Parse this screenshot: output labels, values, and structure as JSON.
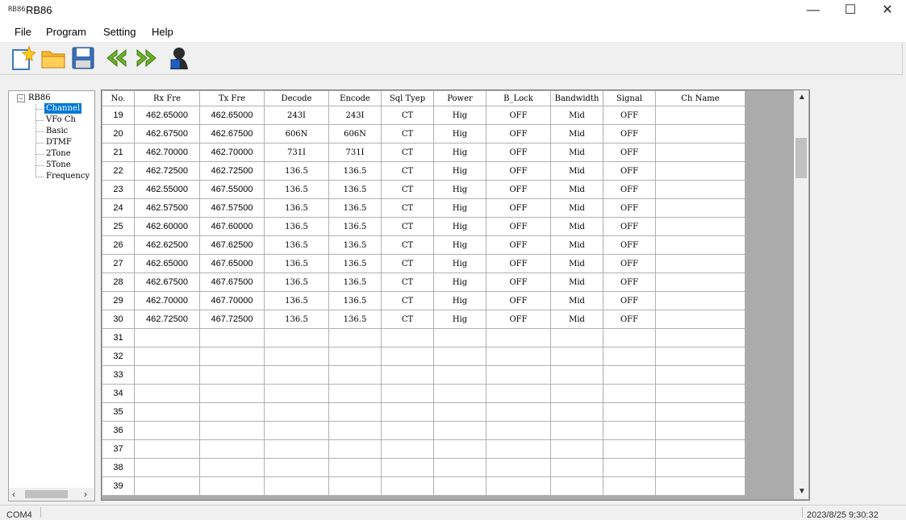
{
  "window": {
    "icon_text": "RB86",
    "title": "RB86",
    "minimize_glyph": "—",
    "maximize_glyph": "☐",
    "close_glyph": "✕"
  },
  "menu": [
    "File",
    "Program",
    "Setting",
    "Help"
  ],
  "toolbar": {
    "icons": [
      "new-file-icon",
      "open-folder-icon",
      "save-icon",
      "previous-icon",
      "next-icon",
      "radio-programmer-icon"
    ]
  },
  "tree": {
    "root": "RB86",
    "items": [
      "Channel",
      "VFo  Ch",
      "Basic",
      "DTMF",
      "2Tone",
      "5Tone",
      "Frequency"
    ],
    "selected": "Channel"
  },
  "table": {
    "headers": [
      "No.",
      "Rx Fre",
      "Tx Fre",
      "Decode",
      "Encode",
      "Sql Tyep",
      "Power",
      "B_Lock",
      "Bandwidth",
      "Signal",
      "Ch Name"
    ],
    "rows": [
      [
        "19",
        "462.65000",
        "462.65000",
        "243I",
        "243I",
        "CT",
        "Hig",
        "OFF",
        "Mid",
        "OFF",
        ""
      ],
      [
        "20",
        "462.67500",
        "462.67500",
        "606N",
        "606N",
        "CT",
        "Hig",
        "OFF",
        "Mid",
        "OFF",
        ""
      ],
      [
        "21",
        "462.70000",
        "462.70000",
        "731I",
        "731I",
        "CT",
        "Hig",
        "OFF",
        "Mid",
        "OFF",
        ""
      ],
      [
        "22",
        "462.72500",
        "462.72500",
        "136.5",
        "136.5",
        "CT",
        "Hig",
        "OFF",
        "Mid",
        "OFF",
        ""
      ],
      [
        "23",
        "462.55000",
        "467.55000",
        "136.5",
        "136.5",
        "CT",
        "Hig",
        "OFF",
        "Mid",
        "OFF",
        ""
      ],
      [
        "24",
        "462.57500",
        "467.57500",
        "136.5",
        "136.5",
        "CT",
        "Hig",
        "OFF",
        "Mid",
        "OFF",
        ""
      ],
      [
        "25",
        "462.60000",
        "467.60000",
        "136.5",
        "136.5",
        "CT",
        "Hig",
        "OFF",
        "Mid",
        "OFF",
        ""
      ],
      [
        "26",
        "462.62500",
        "467.62500",
        "136.5",
        "136.5",
        "CT",
        "Hig",
        "OFF",
        "Mid",
        "OFF",
        ""
      ],
      [
        "27",
        "462.65000",
        "467.65000",
        "136.5",
        "136.5",
        "CT",
        "Hig",
        "OFF",
        "Mid",
        "OFF",
        ""
      ],
      [
        "28",
        "462.67500",
        "467.67500",
        "136.5",
        "136.5",
        "CT",
        "Hig",
        "OFF",
        "Mid",
        "OFF",
        ""
      ],
      [
        "29",
        "462.70000",
        "467.70000",
        "136.5",
        "136.5",
        "CT",
        "Hig",
        "OFF",
        "Mid",
        "OFF",
        ""
      ],
      [
        "30",
        "462.72500",
        "467.72500",
        "136.5",
        "136.5",
        "CT",
        "Hig",
        "OFF",
        "Mid",
        "OFF",
        ""
      ],
      [
        "31",
        "",
        "",
        "",
        "",
        "",
        "",
        "",
        "",
        "",
        ""
      ],
      [
        "32",
        "",
        "",
        "",
        "",
        "",
        "",
        "",
        "",
        "",
        ""
      ],
      [
        "33",
        "",
        "",
        "",
        "",
        "",
        "",
        "",
        "",
        "",
        ""
      ],
      [
        "34",
        "",
        "",
        "",
        "",
        "",
        "",
        "",
        "",
        "",
        ""
      ],
      [
        "35",
        "",
        "",
        "",
        "",
        "",
        "",
        "",
        "",
        "",
        ""
      ],
      [
        "36",
        "",
        "",
        "",
        "",
        "",
        "",
        "",
        "",
        "",
        ""
      ],
      [
        "37",
        "",
        "",
        "",
        "",
        "",
        "",
        "",
        "",
        "",
        ""
      ],
      [
        "38",
        "",
        "",
        "",
        "",
        "",
        "",
        "",
        "",
        "",
        ""
      ],
      [
        "39",
        "",
        "",
        "",
        "",
        "",
        "",
        "",
        "",
        "",
        ""
      ]
    ]
  },
  "statusbar": {
    "port": "COM4",
    "datetime": "2023/8/25 9:30:32"
  },
  "colors": {
    "selection": "#0078d7",
    "grid_line": "#b0b0b0",
    "empty_area": "#ababab"
  }
}
